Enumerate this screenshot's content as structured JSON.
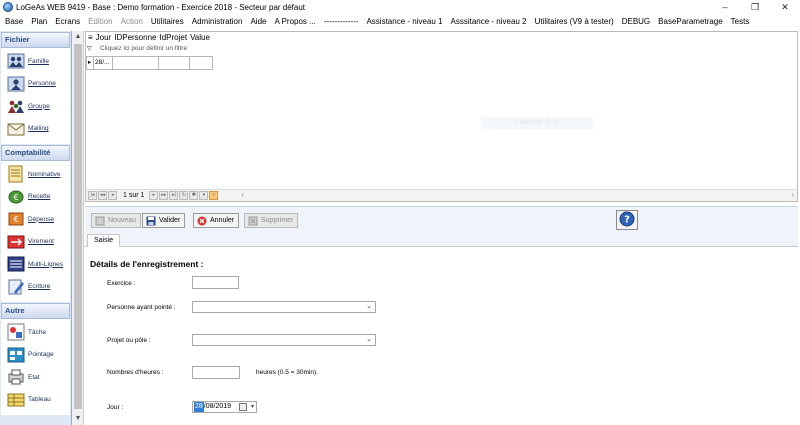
{
  "window": {
    "title": "LoGeAs WEB 9419 - Base : Demo formation - Exercice 2018 - Secteur par défaut",
    "controls": [
      "–",
      "❐",
      "✕"
    ]
  },
  "menu": [
    {
      "label": "Base",
      "enabled": true
    },
    {
      "label": "Plan",
      "enabled": true
    },
    {
      "label": "Ecrans",
      "enabled": true
    },
    {
      "label": "Edition",
      "enabled": false
    },
    {
      "label": "Action",
      "enabled": false
    },
    {
      "label": "Utilitaires",
      "enabled": true
    },
    {
      "label": "Administration",
      "enabled": true
    },
    {
      "label": "Aide",
      "enabled": true
    },
    {
      "label": "A Propos ...",
      "enabled": true
    },
    {
      "label": "-------------",
      "enabled": true
    },
    {
      "label": "Assistance - niveau 1",
      "enabled": true
    },
    {
      "label": "Asssitance - niveau 2",
      "enabled": true
    },
    {
      "label": "Utilitaires  (V9 à tester)",
      "enabled": true
    },
    {
      "label": "DEBUG",
      "enabled": true
    },
    {
      "label": "BaseParametrage",
      "enabled": true
    },
    {
      "label": "Tests",
      "enabled": true
    }
  ],
  "sidebar": {
    "sections": [
      {
        "title": "Fichier",
        "items": [
          {
            "label": "Famille",
            "icon": "family-icon"
          },
          {
            "label": "Personne",
            "icon": "person-icon"
          },
          {
            "label": "Groupe",
            "icon": "group-icon"
          },
          {
            "label": "Mailing",
            "icon": "mail-icon"
          }
        ]
      },
      {
        "title": "Comptabilité",
        "items": [
          {
            "label": "Nominative",
            "icon": "ledger-icon"
          },
          {
            "label": "Recette",
            "icon": "income-icon"
          },
          {
            "label": "Dépense",
            "icon": "expense-icon"
          },
          {
            "label": "Virement",
            "icon": "transfer-icon"
          },
          {
            "label": "Multi-Lignes",
            "icon": "multi-lines-icon"
          },
          {
            "label": "Ecriture",
            "icon": "entry-icon"
          }
        ]
      },
      {
        "title": "Autre",
        "items": [
          {
            "label": "Tâche",
            "icon": "task-icon"
          },
          {
            "label": "Pointage",
            "icon": "timesheet-icon"
          },
          {
            "label": "Etat",
            "icon": "report-icon"
          },
          {
            "label": "Tableau",
            "icon": "table-icon"
          }
        ]
      }
    ]
  },
  "grid": {
    "columns": [
      "Jour",
      "IDPersonne",
      "IdProjet",
      "Value"
    ],
    "filter_placeholder": "Cliquez ici pour définir un filtre",
    "row": [
      "28/...",
      "",
      "",
      "",
      ""
    ],
    "watermark": "Calendar (b d)",
    "pager_text": "1 sur 1"
  },
  "toolbar": {
    "nouveau": "Nouveau",
    "valider": "Valider",
    "annuler": "Annuler",
    "supprimer": "Supprimer"
  },
  "tabs": [
    "Saisie"
  ],
  "form": {
    "title": "Détails de l'enregistrement :",
    "exercice_label": "Exercice :",
    "exercice_value": "",
    "personne_label": "Personne ayant pointé :",
    "personne_value": "",
    "projet_label": "Projet ou pôle :",
    "projet_value": "",
    "heures_label": "Nombres d'heures :",
    "heures_value": "",
    "heures_hint": "heures (0.5 = 30min).",
    "jour_label": "Jour :",
    "jour_day": "28",
    "jour_rest": "/08/2019"
  },
  "colors": {
    "sidebar_bg": "#dfe8f5",
    "section_text": "#2a4c86",
    "toolbar_bg": "#eef4f9",
    "selection": "#2f7fd6"
  }
}
